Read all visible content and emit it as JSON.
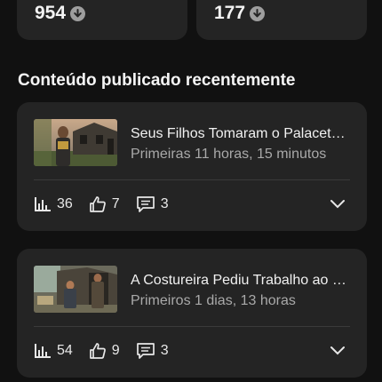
{
  "stats": [
    {
      "value": "954",
      "icon": "arrow-down-circle-icon"
    },
    {
      "value": "177",
      "icon": "arrow-down-circle-icon"
    }
  ],
  "section_title": "Conteúdo publicado recentemente",
  "videos": [
    {
      "title": "Seus Filhos Tomaram o Palacete da Viúva",
      "age": "Primeiras 11 horas, 15 minutos",
      "views": "36",
      "likes": "7",
      "comments": "3"
    },
    {
      "title": "A Costureira Pediu Trabalho ao Fazendeiro",
      "age": "Primeiros 1 dias, 13 horas",
      "views": "54",
      "likes": "9",
      "comments": "3"
    }
  ],
  "colors": {
    "background": "#111111",
    "card": "#242424",
    "secondary_text": "#a9a9a9"
  }
}
